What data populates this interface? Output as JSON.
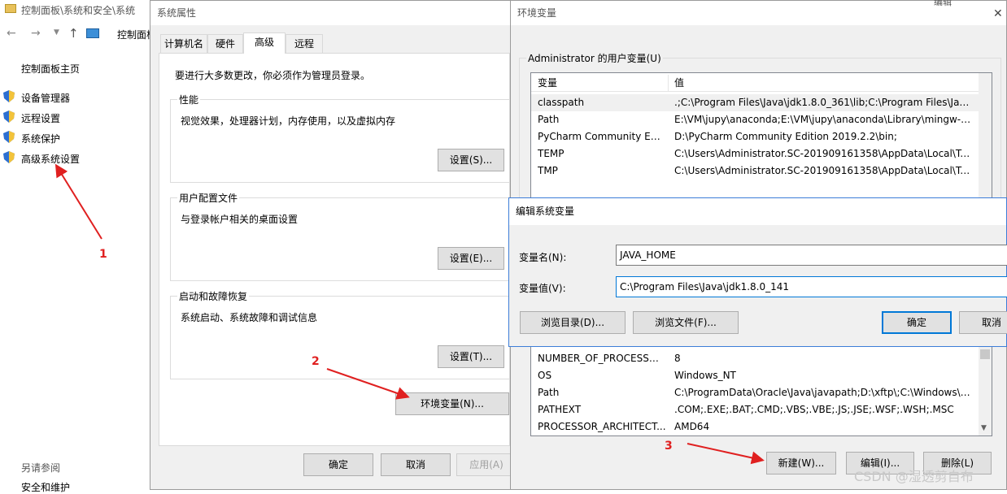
{
  "colors": {
    "accent": "#0078d7",
    "annotation": "#e02020",
    "dialog_bg": "#f0f0f0"
  },
  "control_panel": {
    "title": "控制面板\\系统和安全\\系统",
    "breadcrumb": "控制面板",
    "home_link": "控制面板主页",
    "links": [
      "设备管理器",
      "远程设置",
      "系统保护",
      "高级系统设置"
    ],
    "see_also": "另请参阅",
    "bottom_link": "安全和维护"
  },
  "sys_props": {
    "title": "系统属性",
    "tabs": [
      "计算机名",
      "硬件",
      "高级",
      "远程"
    ],
    "admin_note": "要进行大多数更改，你必须作为管理员登录。",
    "perf": {
      "label": "性能",
      "desc": "视觉效果，处理器计划，内存使用，以及虚拟内存",
      "button": "设置(S)..."
    },
    "profile": {
      "label": "用户配置文件",
      "desc": "与登录帐户相关的桌面设置",
      "button": "设置(E)..."
    },
    "startup": {
      "label": "启动和故障恢复",
      "desc": "系统启动、系统故障和调试信息",
      "button": "设置(T)..."
    },
    "env_button": "环境变量(N)...",
    "ok": "确定",
    "cancel": "取消",
    "apply": "应用(A)"
  },
  "env_vars": {
    "title": "环境变量",
    "user_group": "Administrator 的用户变量(U)",
    "headers": {
      "name": "变量",
      "value": "值"
    },
    "user_rows": [
      {
        "name": "classpath",
        "value": ".;C:\\Program Files\\Java\\jdk1.8.0_361\\lib;C:\\Program Files\\Java..."
      },
      {
        "name": "Path",
        "value": "E:\\VM\\jupy\\anaconda;E:\\VM\\jupy\\anaconda\\Library\\mingw-w..."
      },
      {
        "name": "PyCharm Community Editi...",
        "value": "D:\\PyCharm Community Edition 2019.2.2\\bin;"
      },
      {
        "name": "TEMP",
        "value": "C:\\Users\\Administrator.SC-201909161358\\AppData\\Local\\Te..."
      },
      {
        "name": "TMP",
        "value": "C:\\Users\\Administrator.SC-201909161358\\AppData\\Local\\Te..."
      }
    ],
    "sys_rows": [
      {
        "name": "NUMBER_OF_PROCESSORS",
        "value": "8"
      },
      {
        "name": "OS",
        "value": "Windows_NT"
      },
      {
        "name": "Path",
        "value": "C:\\ProgramData\\Oracle\\Java\\javapath;D:\\xftp\\;C:\\Windows\\sy..."
      },
      {
        "name": "PATHEXT",
        "value": ".COM;.EXE;.BAT;.CMD;.VBS;.VBE;.JS;.JSE;.WSF;.WSH;.MSC"
      },
      {
        "name": "PROCESSOR_ARCHITECT...",
        "value": "AMD64"
      }
    ],
    "new_button": "新建(W)...",
    "edit_button": "编辑(I)...",
    "delete_button": "删除(L)"
  },
  "edit_dialog": {
    "title": "编辑系统变量",
    "name_label": "变量名(N):",
    "name_value": "JAVA_HOME",
    "value_label": "变量值(V):",
    "value_value": "C:\\Program Files\\Java\\jdk1.8.0_141",
    "browse_dir": "浏览目录(D)...",
    "browse_file": "浏览文件(F)...",
    "ok": "确定",
    "cancel": "取消"
  },
  "annotations": [
    "1",
    "2",
    "3"
  ],
  "watermark": "CSDN @湿透剪自布",
  "behind_window_label": "编辑"
}
